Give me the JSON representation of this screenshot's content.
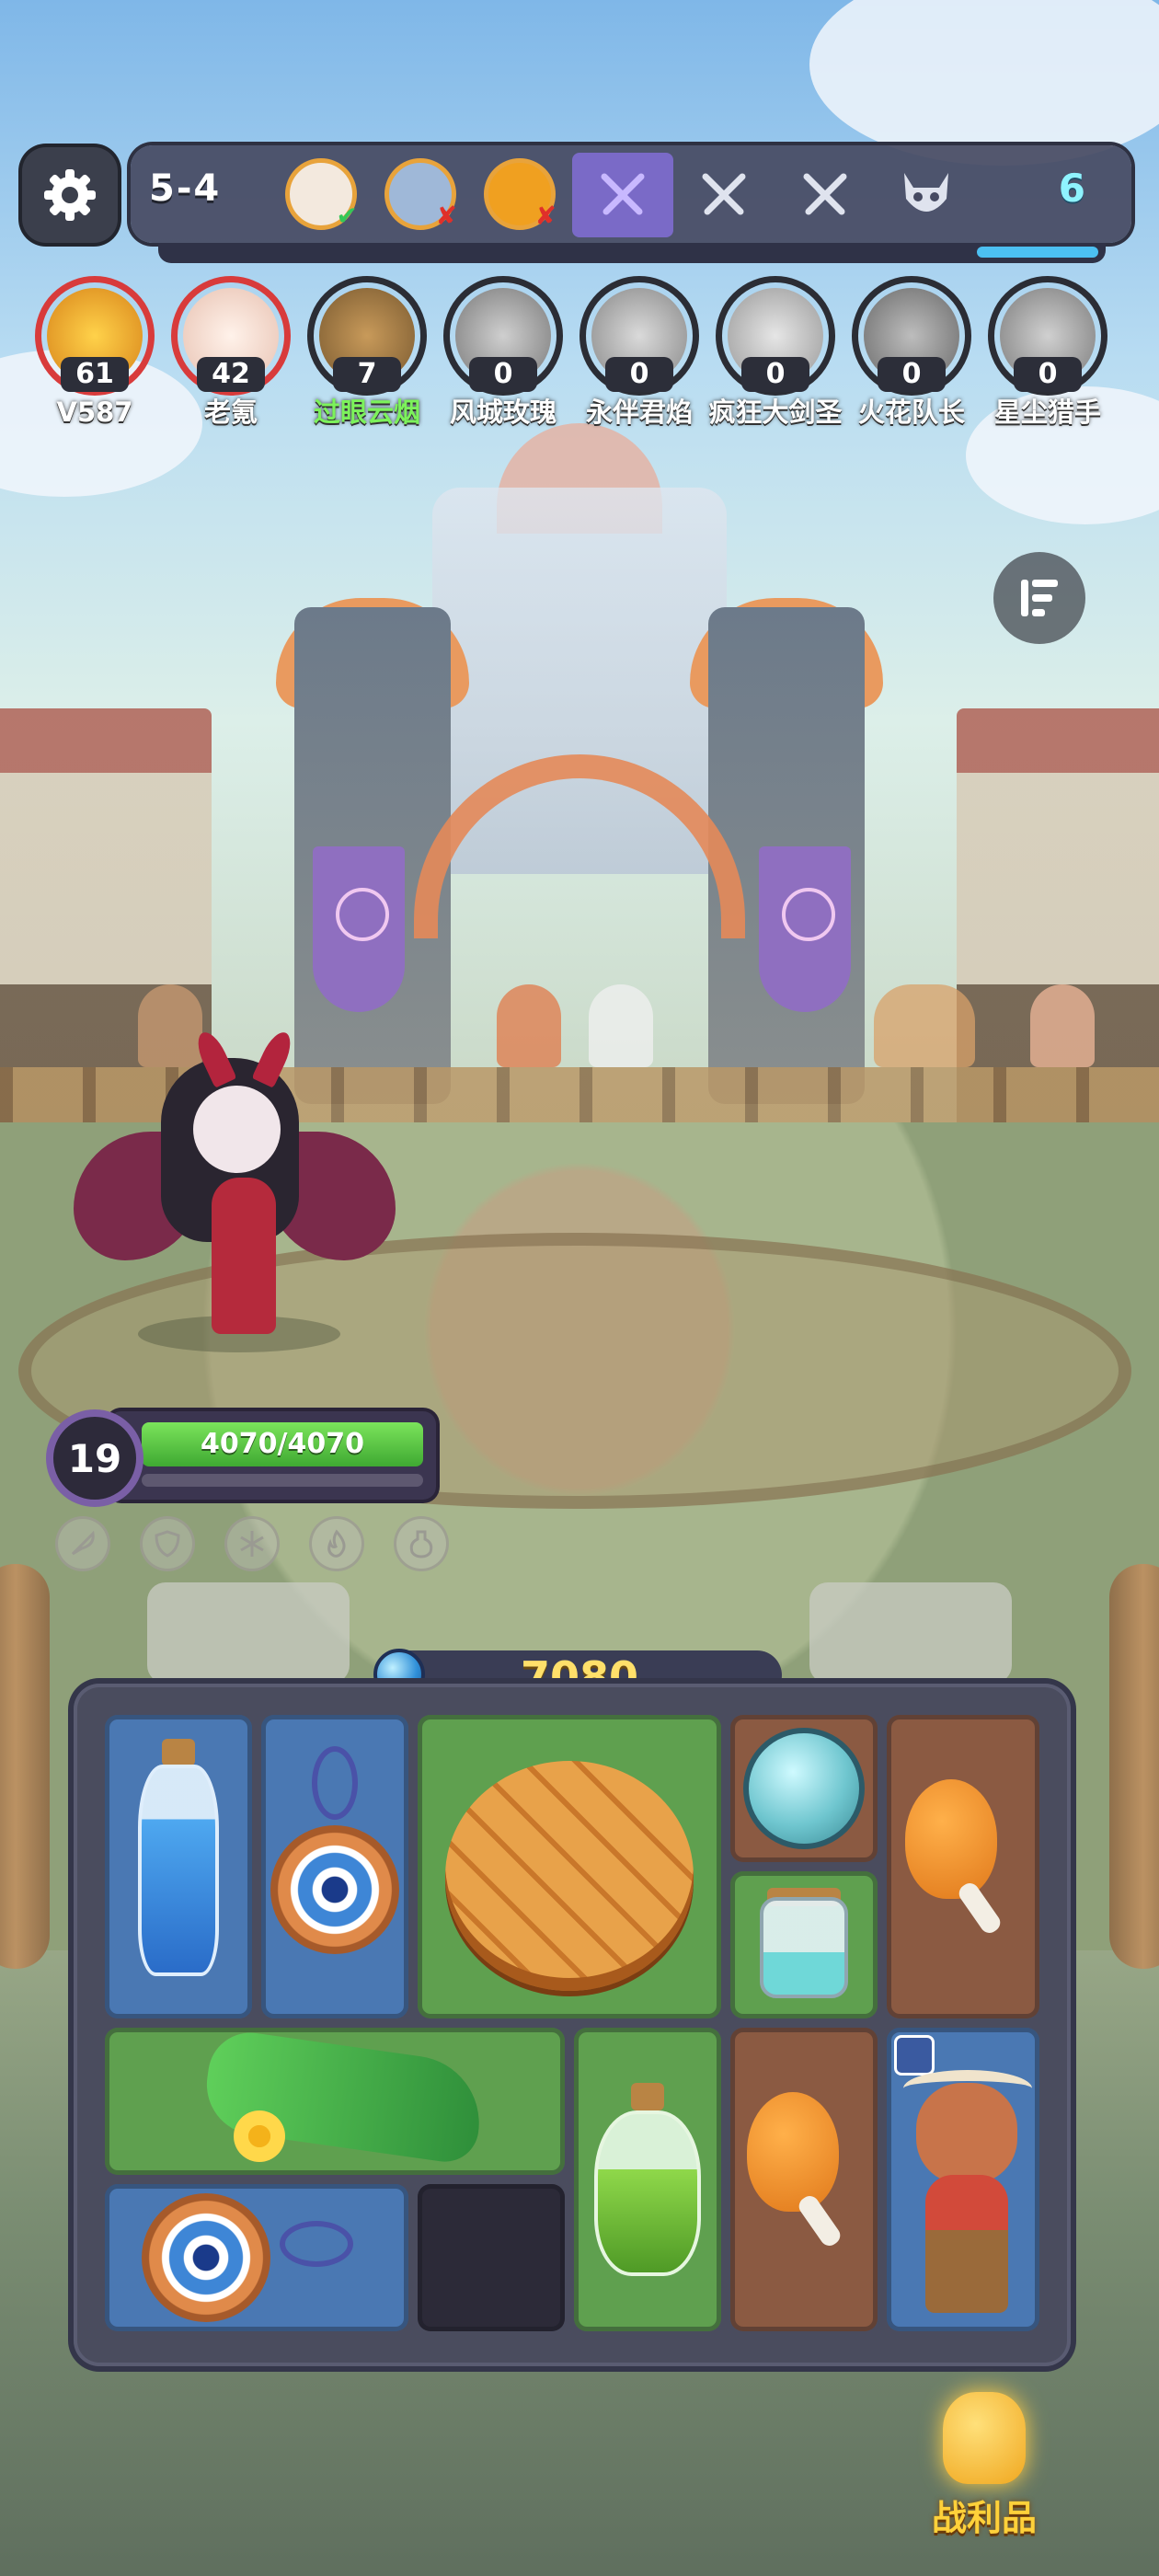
{
  "top_bar": {
    "stage": "5-4",
    "opponents": [
      {
        "result": "win",
        "mark": "✔",
        "mark_color": "#34c759"
      },
      {
        "result": "loss",
        "mark": "✘",
        "mark_color": "#e0302a"
      },
      {
        "result": "loss",
        "mark": "✘",
        "mark_color": "#e0302a"
      }
    ],
    "round_count": "6",
    "round_progress": 0.13
  },
  "players": [
    {
      "score": "61",
      "name": "V587",
      "ring": "red",
      "avatar_color": "#f0b030",
      "name_color": "white"
    },
    {
      "score": "42",
      "name": "老氪",
      "ring": "red",
      "avatar_color": "#f6e4d8",
      "name_color": "white"
    },
    {
      "score": "7",
      "name": "过眼云烟",
      "ring": "gray",
      "avatar_color": "#8a6a3a",
      "name_color": "green"
    },
    {
      "score": "0",
      "name": "风城玫瑰",
      "ring": "gray",
      "avatar_color": "#9a9a9a",
      "name_color": "white"
    },
    {
      "score": "0",
      "name": "永伴君焰",
      "ring": "gray",
      "avatar_color": "#a8a8a8",
      "name_color": "white"
    },
    {
      "score": "0",
      "name": "疯狂大剑圣",
      "ring": "gray",
      "avatar_color": "#b8b8b8",
      "name_color": "white"
    },
    {
      "score": "0",
      "name": "火花队长",
      "ring": "gray",
      "avatar_color": "#8a8a8a",
      "name_color": "white"
    },
    {
      "score": "0",
      "name": "星尘猎手",
      "ring": "gray",
      "avatar_color": "#9c9c9c",
      "name_color": "white"
    }
  ],
  "hero": {
    "level": "19",
    "hp_text": "4070/4070",
    "status_icons": [
      "feather-icon",
      "shield-icon",
      "snowflake-icon",
      "flame-icon",
      "potion-icon"
    ]
  },
  "gold": "7080",
  "inventory": {
    "items": [
      "blue-potion",
      "eye-charm-pendant",
      "melon-bread",
      "crystal-ball",
      "roast-drumstick",
      "teal-jar",
      "green-scarf",
      "green-potion",
      "roast-drumstick",
      "cow-totem",
      "eye-charm-pendant",
      "empty-slot"
    ]
  },
  "loot_label": "战利品",
  "colors": {
    "accent_gold": "#ffe06a",
    "hp_green": "#5fd04a",
    "panel": "#4a4c5e",
    "item_blue": "#4a78b3",
    "item_green": "#5fa04f",
    "item_brown": "#8b5a42"
  }
}
